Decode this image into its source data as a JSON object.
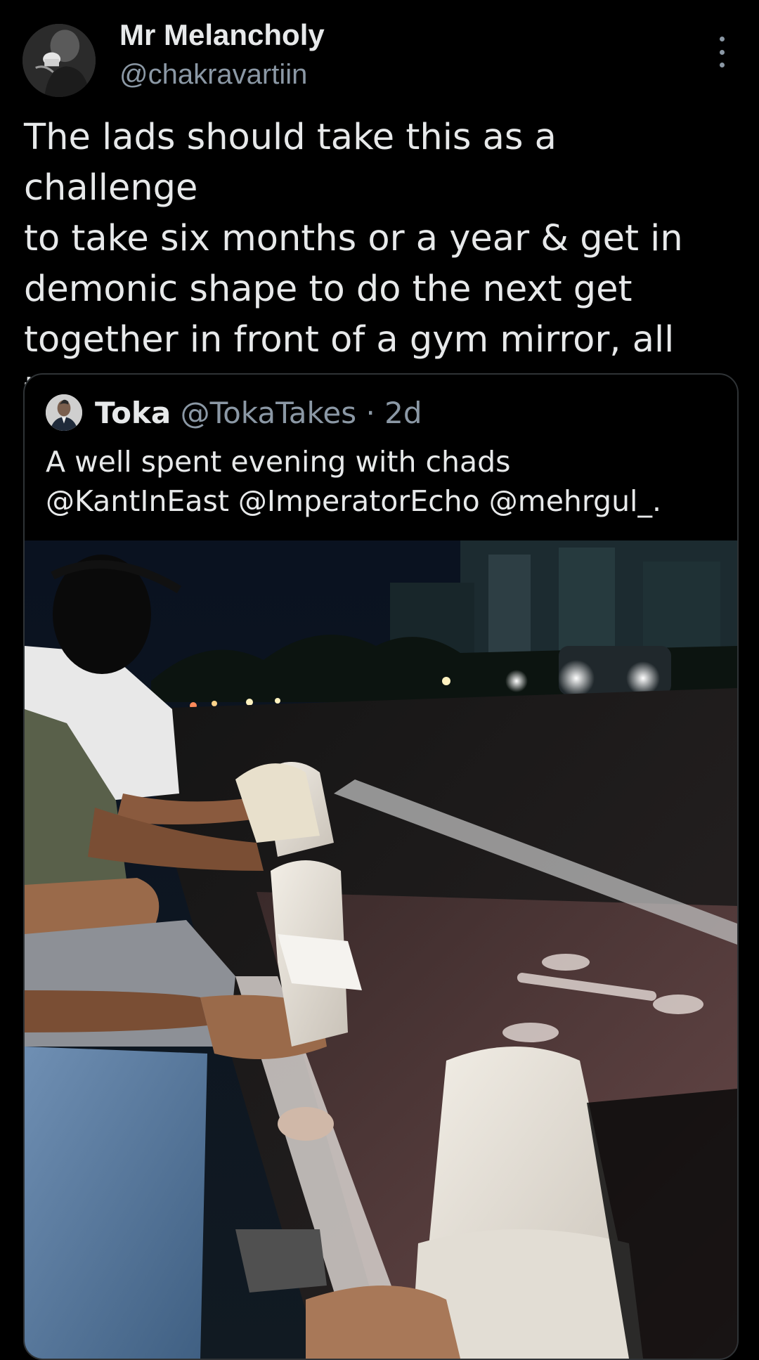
{
  "post": {
    "author": {
      "name": "Mr Melancholy",
      "handle": "@chakravartiin"
    },
    "text": "The lads should take this as a challenge\nto take six months or a year & get in\ndemonic shape to do the next get\ntogether in front of a gym mirror, all the\nmotivation they need is here.",
    "more_icon": "more-vertical-icon"
  },
  "quote": {
    "author": {
      "name": "Toka",
      "handle": "@TokaTakes",
      "separator": "·",
      "time": "2d"
    },
    "text": "A well spent evening with chads\n@KantInEast @ImperatorEcho @mehrgul_."
  },
  "colors": {
    "background": "#000000",
    "primary_text": "#e7e9ea",
    "secondary_text": "#8b98a5",
    "border": "#2f3336"
  }
}
